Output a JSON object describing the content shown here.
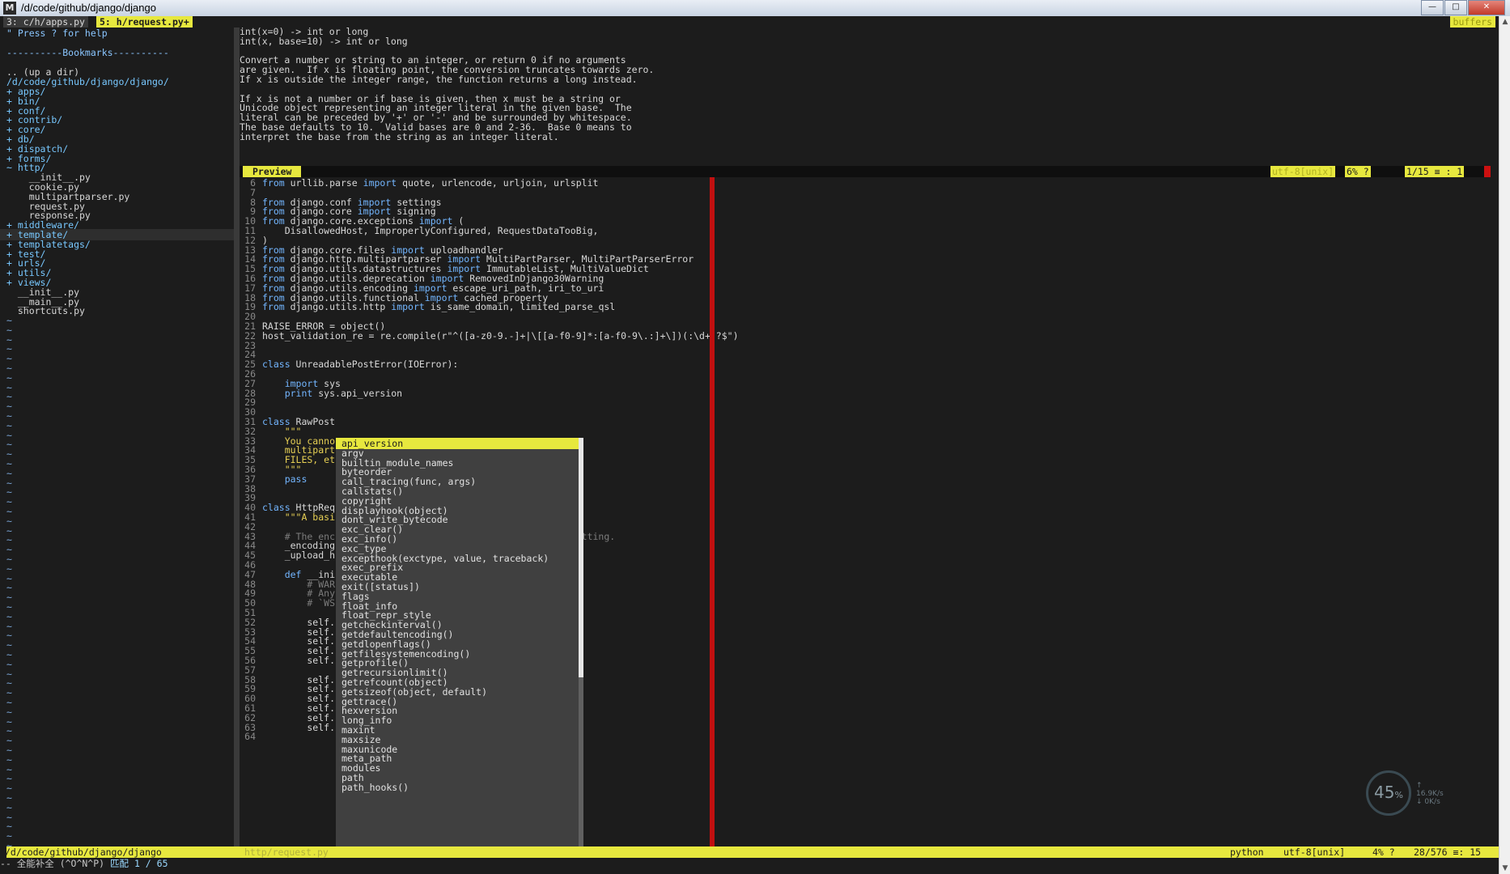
{
  "window": {
    "app_icon": "M",
    "title": "/d/code/github/django/django",
    "buttons": {
      "minimize": "—",
      "maximize": "□",
      "close": "✕"
    }
  },
  "tabline": {
    "tabs": [
      {
        "label": "3: c/h/apps.py"
      },
      {
        "label": "5: h/request.py+"
      }
    ],
    "buffers_label": "buffers"
  },
  "nerdtree": {
    "help": "\" Press ? for help",
    "bookmarks": "----------Bookmarks----------",
    "up_dir": ".. (up a dir)",
    "root": "/d/code/github/django/django/",
    "entries": [
      {
        "text": "+ apps/"
      },
      {
        "text": "+ bin/"
      },
      {
        "text": "+ conf/"
      },
      {
        "text": "+ contrib/"
      },
      {
        "text": "+ core/"
      },
      {
        "text": "+ db/"
      },
      {
        "text": "+ dispatch/"
      },
      {
        "text": "+ forms/"
      },
      {
        "text": "~ http/"
      },
      {
        "text": "    __init__.py"
      },
      {
        "text": "    cookie.py"
      },
      {
        "text": "    multipartparser.py"
      },
      {
        "text": "    request.py"
      },
      {
        "text": "    response.py"
      },
      {
        "text": "+ middleware/"
      },
      {
        "text": "+ template/"
      },
      {
        "text": "+ templatetags/"
      },
      {
        "text": "+ test/"
      },
      {
        "text": "+ urls/"
      },
      {
        "text": "+ utils/"
      },
      {
        "text": "+ views/"
      },
      {
        "text": "  __init__.py"
      },
      {
        "text": "  __main__.py"
      },
      {
        "text": "  shortcuts.py"
      }
    ]
  },
  "preview": {
    "lines": [
      "int(x=0) -> int or long",
      "int(x, base=10) -> int or long",
      "",
      "Convert a number or string to an integer, or return 0 if no arguments",
      "are given.  If x is floating point, the conversion truncates towards zero.",
      "If x is outside the integer range, the function returns a long instead.",
      "",
      "If x is not a number or if base is given, then x must be a string or",
      "Unicode object representing an integer literal in the given base.  The",
      "literal can be preceded by '+' or '-' and be surrounded by whitespace.",
      "The base defaults to 10.  Valid bases are 0 and 2-36.  Base 0 means to",
      "interpret the base from the string as an integer literal."
    ],
    "status_label": "Preview",
    "status_encoding": "utf-8[unix]",
    "status_percent": "6% ?",
    "status_position": "1/15 ≡ : 1"
  },
  "code": {
    "lines": [
      {
        "n": "6",
        "t": "from urllib.parse import quote, urlencode, urljoin, urlsplit"
      },
      {
        "n": "7",
        "t": ""
      },
      {
        "n": "8",
        "t": "from django.conf import settings"
      },
      {
        "n": "9",
        "t": "from django.core import signing"
      },
      {
        "n": "10",
        "t": "from django.core.exceptions import ("
      },
      {
        "n": "11",
        "t": "    DisallowedHost, ImproperlyConfigured, RequestDataTooBig,"
      },
      {
        "n": "12",
        "t": ")"
      },
      {
        "n": "13",
        "t": "from django.core.files import uploadhandler"
      },
      {
        "n": "14",
        "t": "from django.http.multipartparser import MultiPartParser, MultiPartParserError"
      },
      {
        "n": "15",
        "t": "from django.utils.datastructures import ImmutableList, MultiValueDict"
      },
      {
        "n": "16",
        "t": "from django.utils.deprecation import RemovedInDjango30Warning"
      },
      {
        "n": "17",
        "t": "from django.utils.encoding import escape_uri_path, iri_to_uri"
      },
      {
        "n": "18",
        "t": "from django.utils.functional import cached_property"
      },
      {
        "n": "19",
        "t": "from django.utils.http import is_same_domain, limited_parse_qsl"
      },
      {
        "n": "20",
        "t": ""
      },
      {
        "n": "21",
        "t": "RAISE_ERROR = object()"
      },
      {
        "n": "22",
        "t": "host_validation_re = re.compile(r\"^([a-z0-9.-]+|\\[[a-f0-9]*:[a-f0-9\\.:]+\\])(:\\d+)?$\")"
      },
      {
        "n": "23",
        "t": ""
      },
      {
        "n": "24",
        "t": ""
      },
      {
        "n": "25",
        "t": "class UnreadablePostError(IOError):"
      },
      {
        "n": "26",
        "t": ""
      },
      {
        "n": "27",
        "t": "    import sys"
      },
      {
        "n": "28",
        "t": "    print sys.api_version"
      },
      {
        "n": "29",
        "t": ""
      },
      {
        "n": "30",
        "t": ""
      },
      {
        "n": "31",
        "t": "class RawPost"
      },
      {
        "n": "32",
        "t": "    \"\"\""
      },
      {
        "n": "33",
        "t": "    You canno                                  s"
      },
      {
        "n": "34",
        "t": "    multipart                                  ,"
      },
      {
        "n": "35",
        "t": "    FILES, et"
      },
      {
        "n": "36",
        "t": "    \"\"\""
      },
      {
        "n": "37",
        "t": "    pass"
      },
      {
        "n": "38",
        "t": ""
      },
      {
        "n": "39",
        "t": ""
      },
      {
        "n": "40",
        "t": "class HttpReq"
      },
      {
        "n": "41",
        "t": "    \"\"\"A basi"
      },
      {
        "n": "42",
        "t": ""
      },
      {
        "n": "43",
        "t": "    # The enc                                  default setting."
      },
      {
        "n": "44",
        "t": "    _encoding"
      },
      {
        "n": "45",
        "t": "    _upload_h"
      },
      {
        "n": "46",
        "t": ""
      },
      {
        "n": "47",
        "t": "    def __ini"
      },
      {
        "n": "48",
        "t": "        # WAR                                 `super`."
      },
      {
        "n": "49",
        "t": "        # Any                                ppen in"
      },
      {
        "n": "50",
        "t": "        # `WS"
      },
      {
        "n": "51",
        "t": ""
      },
      {
        "n": "52",
        "t": "        self."
      },
      {
        "n": "53",
        "t": "        self."
      },
      {
        "n": "54",
        "t": "        self."
      },
      {
        "n": "55",
        "t": "        self."
      },
      {
        "n": "56",
        "t": "        self."
      },
      {
        "n": "57",
        "t": ""
      },
      {
        "n": "58",
        "t": "        self."
      },
      {
        "n": "59",
        "t": "        self."
      },
      {
        "n": "60",
        "t": "        self."
      },
      {
        "n": "61",
        "t": "        self."
      },
      {
        "n": "62",
        "t": "        self."
      },
      {
        "n": "63",
        "t": "        self."
      },
      {
        "n": "64",
        "t": ""
      }
    ]
  },
  "completion": {
    "items": [
      "api_version",
      "argv",
      "builtin_module_names",
      "byteorder",
      "call_tracing(func, args)",
      "callstats()",
      "copyright",
      "displayhook(object)",
      "dont_write_bytecode",
      "exc_clear()",
      "exc_info()",
      "exc_type",
      "excepthook(exctype, value, traceback)",
      "exec_prefix",
      "executable",
      "exit([status])",
      "flags",
      "float_info",
      "float_repr_style",
      "getcheckinterval()",
      "getdefaultencoding()",
      "getdlopenflags()",
      "getfilesystemencoding()",
      "getprofile()",
      "getrecursionlimit()",
      "getrefcount(object)",
      "getsizeof(object, default)",
      "gettrace()",
      "hexversion",
      "long_info",
      "maxint",
      "maxsize",
      "maxunicode",
      "meta_path",
      "modules",
      "path",
      "path_hooks()"
    ],
    "selected_index": 0
  },
  "statusline": {
    "left": "/d/code/github/django/django",
    "inactive": "http/request.py",
    "filetype": "python",
    "encoding": "utf-8[unix]",
    "percent": "4% ?",
    "position": "28/576 ≡: 15"
  },
  "cmdline": {
    "mode": "-- 全能补全 (^O^N^P)",
    "match": "匹配 1 / 65"
  },
  "netwidget": {
    "percent": "45",
    "percent_unit": "%",
    "upload": "16.9",
    "upload_unit": "K/s",
    "download": "0",
    "download_unit": "K/s"
  },
  "colors": {
    "accent_yellow": "#e7e83e",
    "color_column": "#c11010",
    "directory": "#78c8ff",
    "keyword": "#73b6ff",
    "popup_bg": "#404040"
  }
}
